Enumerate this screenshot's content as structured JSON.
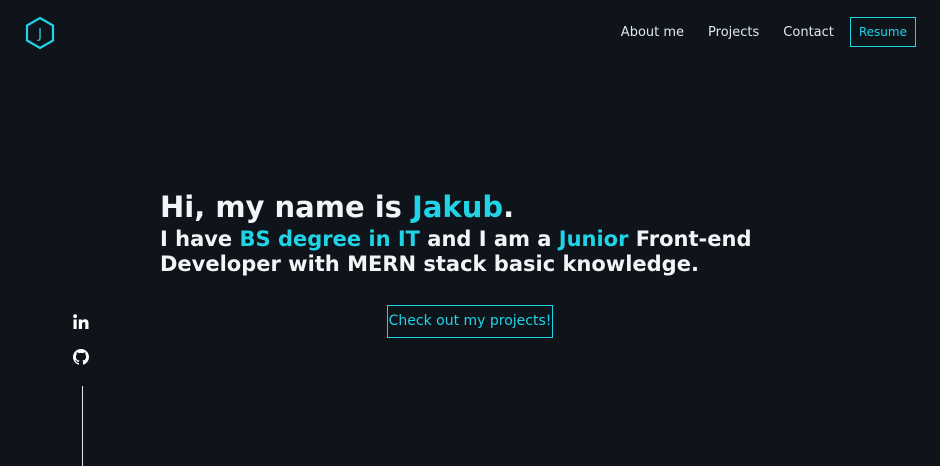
{
  "header": {
    "logo_letter": "J",
    "nav": {
      "about": "About me",
      "projects": "Projects",
      "contact": "Contact",
      "resume": "Resume"
    }
  },
  "hero": {
    "line1_prefix": "Hi, my name is ",
    "line1_name": "Jakub",
    "line1_suffix": ".",
    "line2_a": "I have ",
    "line2_degree": "BS degree in IT",
    "line2_b": " and I am a ",
    "line2_level": "Junior",
    "line2_c": " Front-end",
    "line3": "Developer with MERN stack basic knowledge.",
    "cta_label": "Check out my projects!"
  },
  "social": {
    "icons": [
      "linkedin-icon",
      "github-icon"
    ]
  },
  "colors": {
    "background": "#0f141b",
    "accent": "#20d3e6",
    "text": "#f2f5f7"
  }
}
